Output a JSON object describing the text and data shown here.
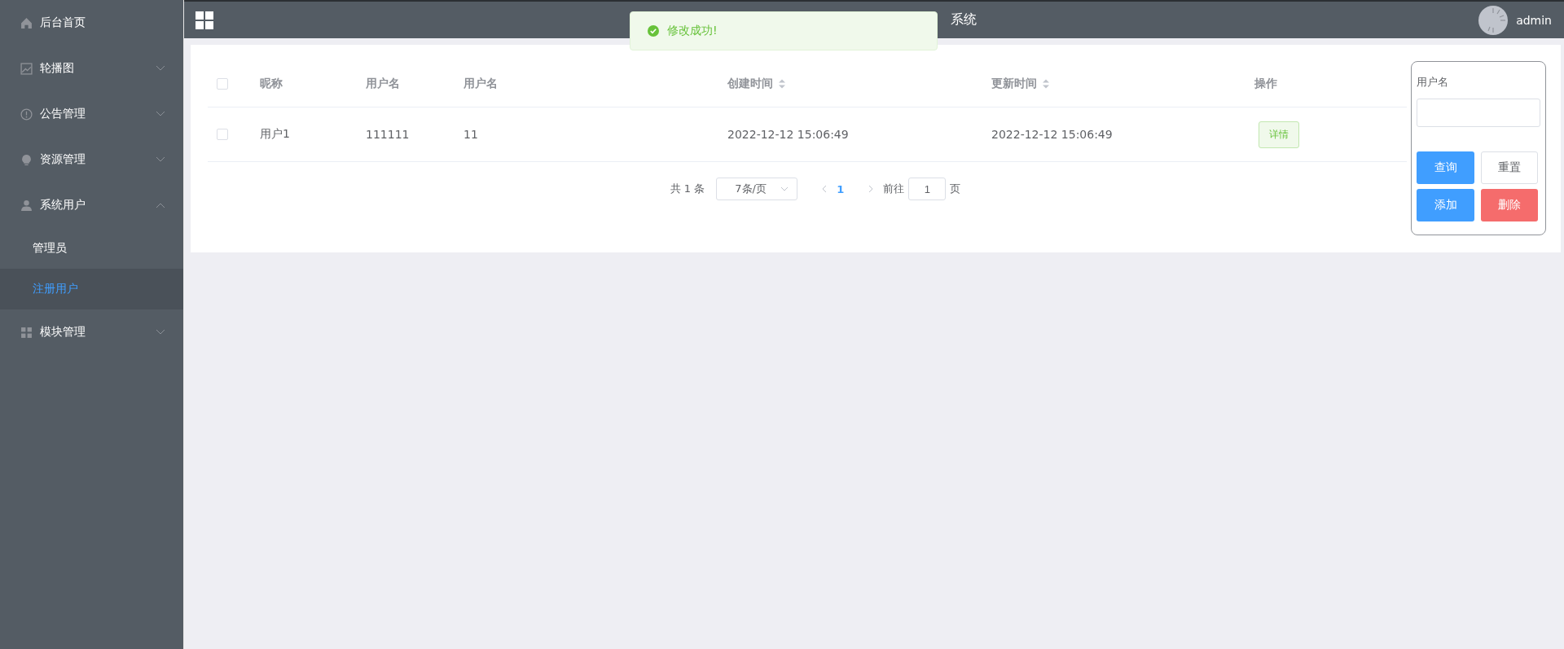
{
  "sidebar": {
    "items": [
      {
        "label": "后台首页",
        "kind": "link"
      },
      {
        "label": "轮播图",
        "kind": "submenu",
        "expanded": false
      },
      {
        "label": "公告管理",
        "kind": "submenu",
        "expanded": false
      },
      {
        "label": "资源管理",
        "kind": "submenu",
        "expanded": false
      },
      {
        "label": "系统用户",
        "kind": "submenu",
        "expanded": true,
        "children": [
          {
            "label": "管理员",
            "selected": false
          },
          {
            "label": "注册用户",
            "selected": true
          }
        ]
      },
      {
        "label": "模块管理",
        "kind": "submenu",
        "expanded": false
      }
    ]
  },
  "header": {
    "title": "系统",
    "user": "admin"
  },
  "toast": {
    "kind": "success",
    "message": "修改成功!"
  },
  "table": {
    "all_selected": false,
    "columns": [
      {
        "label": "昵称",
        "sortable": false
      },
      {
        "label": "用户名",
        "sortable": false
      },
      {
        "label": "用户名",
        "sortable": false
      },
      {
        "label": "创建时间",
        "sortable": true
      },
      {
        "label": "更新时间",
        "sortable": true
      },
      {
        "label": "操作",
        "sortable": false
      }
    ],
    "rows": [
      {
        "selected": false,
        "cells": [
          "用户1",
          "111111",
          "11",
          "2022-12-12 15:06:49",
          "2022-12-12 15:06:49"
        ],
        "action": "详情"
      }
    ]
  },
  "pagination": {
    "total": "共 1 条",
    "page_size": "7条/页",
    "pages": [
      {
        "label": "1",
        "selected": true
      }
    ],
    "goto_label": "前往",
    "goto_value": "1",
    "goto_suffix": "页"
  },
  "search_panel": {
    "field_label": "用户名",
    "buttons": [
      {
        "label": "查询",
        "kind": "primary"
      },
      {
        "label": "重置",
        "kind": "default"
      },
      {
        "label": "添加",
        "kind": "primary"
      },
      {
        "label": "删除",
        "kind": "danger"
      }
    ]
  }
}
